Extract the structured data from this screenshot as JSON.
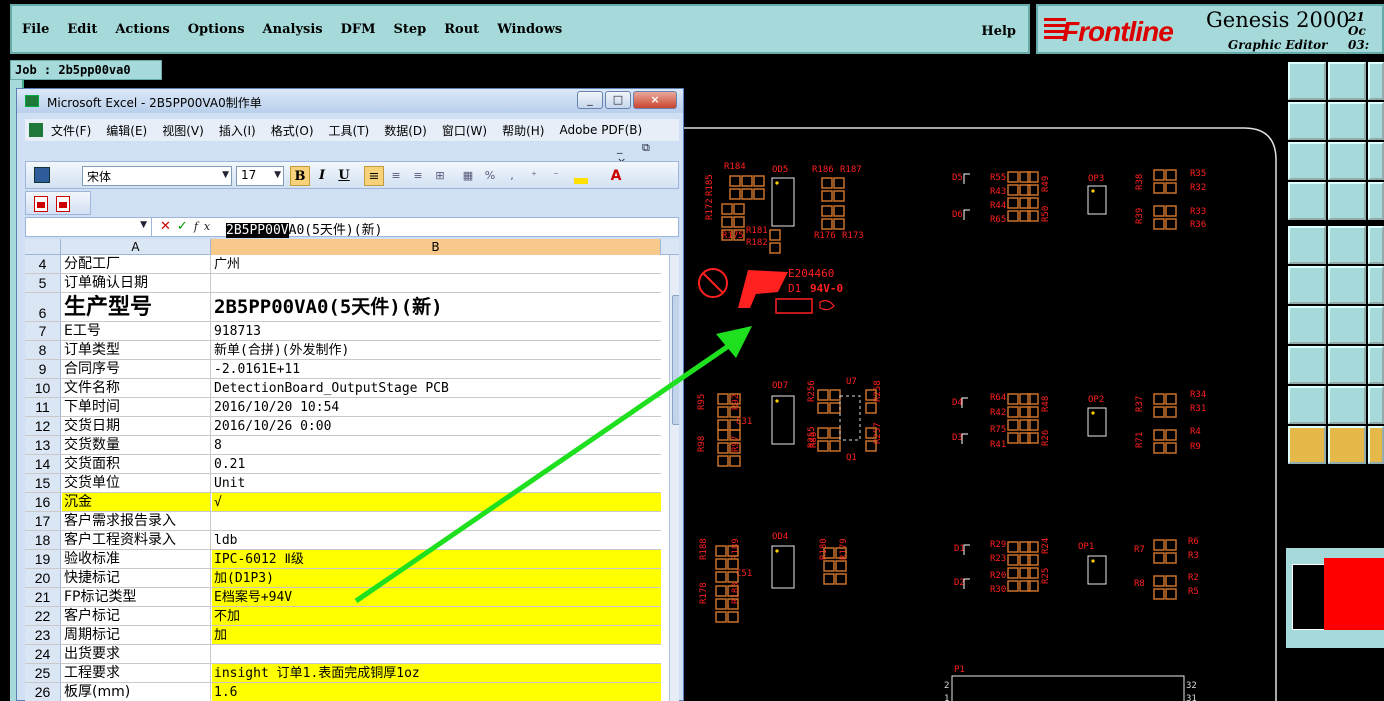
{
  "genesis": {
    "menu": [
      "File",
      "Edit",
      "Actions",
      "Options",
      "Analysis",
      "DFM",
      "Step",
      "Rout",
      "Windows"
    ],
    "help": "Help",
    "logo": "Frontline",
    "product": "Genesis 2000",
    "subtitle": "Graphic Editor",
    "date_line1": "21 Oc",
    "date_line2": "03:",
    "job_label": "Job : 2b5pp00va0",
    "colors": {
      "pcb_copper": "#c8702a",
      "silkscreen": "#ff2020",
      "arrow": "#1fe01f",
      "panel": "#a6dada"
    }
  },
  "pcb": {
    "components": [
      "R184",
      "OD5",
      "R186",
      "R187",
      "R185",
      "R172",
      "R175",
      "R181",
      "R182",
      "R176",
      "R173",
      "D5",
      "D6",
      "R55",
      "R43",
      "R44",
      "R65",
      "R49",
      "R50",
      "OP3",
      "R38",
      "R39",
      "R35",
      "R32",
      "R33",
      "R36",
      "R95",
      "R92",
      "C31",
      "R97",
      "R98",
      "OD7",
      "R256",
      "R255",
      "U7",
      "R258",
      "R257",
      "Q1",
      "R86",
      "D4",
      "D3",
      "R64",
      "R42",
      "R75",
      "R41",
      "R48",
      "R26",
      "OP2",
      "R37",
      "R71",
      "R34",
      "R31",
      "R4",
      "R9",
      "R188",
      "R189",
      "C51",
      "R178",
      "R183",
      "OD4",
      "R180",
      "R179",
      "D1",
      "D2",
      "R29",
      "R23",
      "R20",
      "R30",
      "R24",
      "R25",
      "OP1",
      "R7",
      "R8",
      "R6",
      "R3",
      "R2",
      "R5",
      "P1"
    ],
    "marking_code": "E204460",
    "marking_rating": "94V-0",
    "marking_layer": "D1",
    "connector_pins": [
      "2",
      "1",
      "32",
      "31"
    ]
  },
  "excel": {
    "title": "Microsoft Excel - 2B5PP00VA0制作单",
    "window_buttons": [
      "_",
      "□",
      "×"
    ],
    "menu": [
      "文件(F)",
      "编辑(E)",
      "视图(V)",
      "插入(I)",
      "格式(O)",
      "工具(T)",
      "数据(D)",
      "窗口(W)",
      "帮助(H)",
      "Adobe PDF(B)"
    ],
    "doc_controls": "_ ⧉ ×",
    "font_name": "宋体",
    "font_size": "17",
    "fmt_buttons": {
      "bold": "B",
      "italic": "I",
      "underline": "U"
    },
    "fx_label": "fx",
    "formula_selected": "2B5PP00V",
    "formula_rest": "A0(5天件)(新)",
    "columns": [
      "A",
      "B"
    ],
    "rows": [
      {
        "n": "4",
        "a": "分配工厂",
        "b": "广州"
      },
      {
        "n": "5",
        "a": "订单确认日期",
        "b": ""
      },
      {
        "n": "6",
        "a": "生产型号",
        "b": "2B5PP00VA0(5天件)(新)"
      },
      {
        "n": "7",
        "a": "E工号",
        "b": "918713"
      },
      {
        "n": "8",
        "a": "订单类型",
        "b": "新单(合拼)(外发制作)"
      },
      {
        "n": "9",
        "a": "合同序号",
        "b": "-2.0161E+11"
      },
      {
        "n": "10",
        "a": "文件名称",
        "b": "DetectionBoard_OutputStage PCB"
      },
      {
        "n": "11",
        "a": "下单时间",
        "b": "2016/10/20 10:54"
      },
      {
        "n": "12",
        "a": "交货日期",
        "b": "2016/10/26 0:00"
      },
      {
        "n": "13",
        "a": "交货数量",
        "b": "8"
      },
      {
        "n": "14",
        "a": "交货面积",
        "b": "0.21"
      },
      {
        "n": "15",
        "a": "交货单位",
        "b": "Unit"
      },
      {
        "n": "16",
        "a": "沉金",
        "b": "√"
      },
      {
        "n": "17",
        "a": "客户需求报告录入",
        "b": ""
      },
      {
        "n": "18",
        "a": "客户工程资料录入",
        "b": "ldb"
      },
      {
        "n": "19",
        "a": "验收标准",
        "b": "IPC-6012 Ⅱ级"
      },
      {
        "n": "20",
        "a": "快捷标记",
        "b": "加(D1P3)"
      },
      {
        "n": "21",
        "a": "FP标记类型",
        "b": "E档案号+94V"
      },
      {
        "n": "22",
        "a": "客户标记",
        "b": "不加"
      },
      {
        "n": "23",
        "a": "周期标记",
        "b": "加"
      },
      {
        "n": "24",
        "a": "出货要求",
        "b": ""
      },
      {
        "n": "25",
        "a": "工程要求",
        "b": "insight 订单1.表面完成铜厚1oz"
      },
      {
        "n": "26",
        "a": "板厚(mm)",
        "b": "1.6"
      }
    ]
  }
}
